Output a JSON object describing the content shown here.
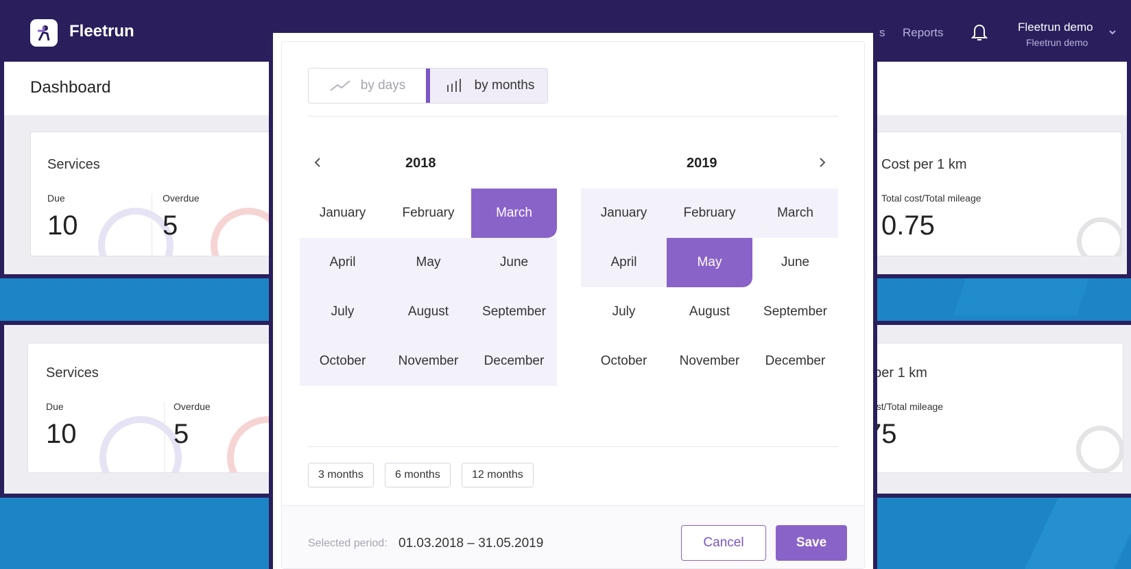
{
  "app": {
    "brand": "Fleetrun",
    "nav_partial": "s",
    "nav_reports": "Reports",
    "user_name": "Fleetrun demo",
    "user_sub": "Fleetrun  demo"
  },
  "dashboard": {
    "title": "Dashboard"
  },
  "cards_top": {
    "services_title": "Services",
    "due_label": "Due",
    "due_value": "10",
    "overdue_label": "Overdue",
    "overdue_value": "5",
    "cost_title": "Cost per 1 km",
    "cost_sub": "Total cost/Total mileage",
    "cost_value": "0.75"
  },
  "cards_bottom": {
    "services_title": "Services",
    "due_label": "Due",
    "due_value": "10",
    "overdue_label": "Overdue",
    "overdue_value": "5",
    "cost_title": "t per 1 km",
    "cost_sub": "cost/Total mileage",
    "cost_value": "75"
  },
  "picker": {
    "mode_days": "by days",
    "mode_months": "by months",
    "active_mode": "by months",
    "year_left": "2018",
    "year_right": "2019",
    "months": [
      "January",
      "February",
      "March",
      "April",
      "May",
      "June",
      "July",
      "August",
      "September",
      "October",
      "November",
      "December"
    ],
    "range_start": "March 2018",
    "range_end": "May 2019",
    "presets": [
      "3 months",
      "6 months",
      "12 months"
    ],
    "selected_label": "Selected period:",
    "selected_value": "01.03.2018 – 31.05.2019",
    "cancel": "Cancel",
    "save": "Save"
  },
  "colors": {
    "appbar": "#2a1f5c",
    "accent": "#8a63c9",
    "background": "#1d85c6"
  }
}
